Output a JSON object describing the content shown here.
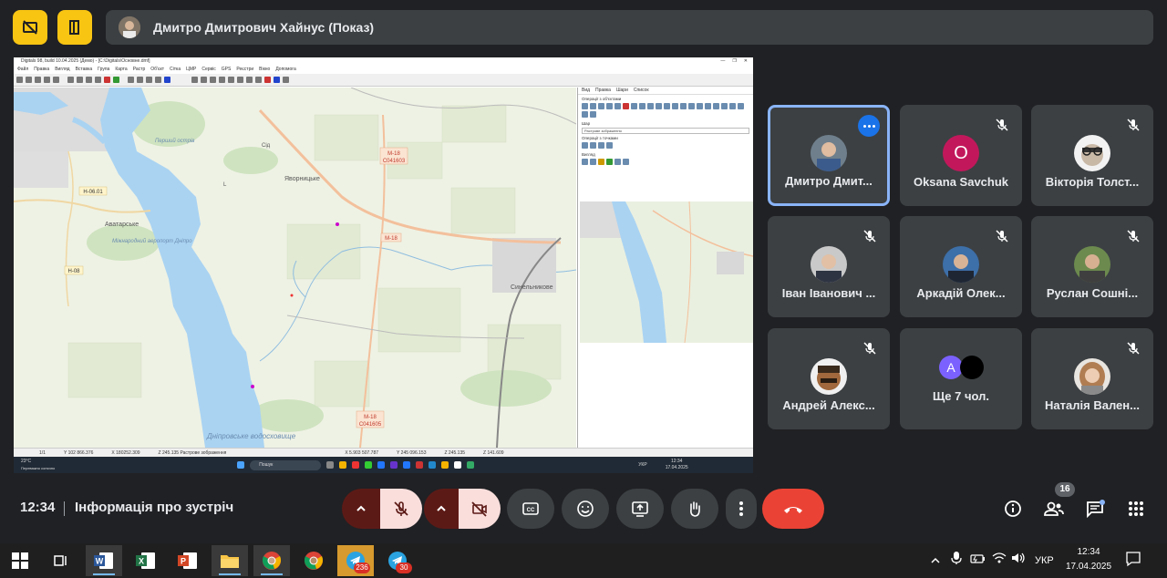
{
  "presenter_bar": {
    "name": "Дмитро Дмитрович Хайнус (Показ)"
  },
  "shared_screen": {
    "window_title": "Digitals 98, build 10.04.2025 (Демо) - [C:\\Digitals\\Основне.dmf]",
    "menu": [
      "Файл",
      "Правка",
      "Вигляд",
      "Вставка",
      "Група",
      "Карта",
      "Растр",
      "Об'єкт",
      "Сітка",
      "ЦМР",
      "Сервіс",
      "GPS",
      "Реєстри",
      "Вікно",
      "Допомога"
    ],
    "panel_tabs": [
      "Вид",
      "Правка",
      "Шари",
      "Список"
    ],
    "panel_sections": [
      "Операції з об'єктами",
      "Шар",
      "Операції з точками",
      "Вигляд"
    ],
    "panel_select": "Растрове зображення",
    "map_labels": {
      "m18_a": "М-18",
      "c041603": "С041603",
      "m18_b": "М-18",
      "m18_c": "М-18",
      "c041605": "С041605",
      "h0601": "Н-06.01",
      "h08": "Н-08",
      "avatorske": "Аватарське",
      "yavornytske": "Яворницьке",
      "synelnykove": "Синельникове",
      "airport": "Міжнародний аеропорт Дніпро",
      "reservoir": "Дніпровське водосховище",
      "island": "Перший острів",
      "l_mark": "L",
      "sid": "Сід"
    },
    "status": [
      "1/1",
      "Y 102 866.376",
      "X 180252.309",
      "Z 245.135 Растрове зображення",
      "X 5.903 507.787",
      "Y 245 096.153",
      "Z 245.135",
      "Z 141.609"
    ],
    "taskbar": {
      "weather": "23°C",
      "weather_sub": "Переважно сонячно",
      "search": "Пошук",
      "lang": "УКР",
      "time": "12:34",
      "date": "17.04.2025"
    }
  },
  "participants": [
    {
      "name": "Дмитро Дмит...",
      "active": true
    },
    {
      "name": "Oksana Savchuk",
      "initial": "O",
      "color": "#c2185b"
    },
    {
      "name": "Вікторія Толст..."
    },
    {
      "name": "Іван Іванович ..."
    },
    {
      "name": "Аркадій Олек..."
    },
    {
      "name": "Руслан Сошні..."
    },
    {
      "name": "Андрей Алекс..."
    },
    {
      "name": "Ще 7 чол.",
      "initial": "А",
      "color": "#7b61ff"
    },
    {
      "name": "Наталія Вален..."
    }
  ],
  "controls": {
    "time": "12:34",
    "meeting_info": "Інформація про зустріч",
    "participants_count": "16"
  },
  "colors": {
    "accent_yellow": "#f9c513",
    "end_call": "#ea4335",
    "mute_bg": "#f9dedc",
    "tile_bg": "#3c4043",
    "active_border": "#8ab4f8"
  },
  "windows_taskbar": {
    "telegram_badge_1": "236",
    "telegram_badge_2": "30",
    "lang": "УКР",
    "time": "12:34",
    "date": "17.04.2025"
  }
}
